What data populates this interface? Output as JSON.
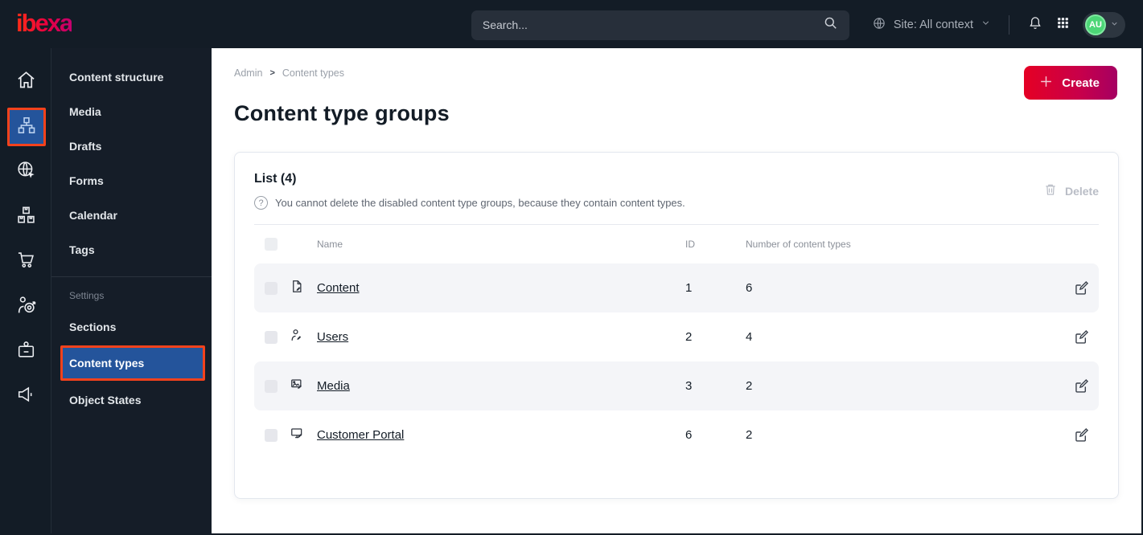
{
  "topbar": {
    "logo_text": "ibexa",
    "search": {
      "placeholder": "Search..."
    },
    "site_context": {
      "label": "Site: All context"
    },
    "avatar": {
      "initials": "AU"
    }
  },
  "sidebar": {
    "menu_items": [
      {
        "label": "Content structure"
      },
      {
        "label": "Media"
      },
      {
        "label": "Drafts"
      },
      {
        "label": "Forms"
      },
      {
        "label": "Calendar"
      },
      {
        "label": "Tags"
      }
    ],
    "section_label": "Settings",
    "settings_items": [
      {
        "label": "Sections"
      },
      {
        "label": "Content types"
      },
      {
        "label": "Object States"
      }
    ]
  },
  "breadcrumb": {
    "items": [
      "Admin",
      "Content types"
    ],
    "separator": ">"
  },
  "page": {
    "title": "Content type groups"
  },
  "toolbar": {
    "create_label": "Create"
  },
  "list_card": {
    "title": "List (4)",
    "info_icon_glyph": "?",
    "info_text": "You cannot delete the disabled content type groups, because they contain content types.",
    "delete_label": "Delete",
    "table": {
      "headers": {
        "name": "Name",
        "id": "ID",
        "count": "Number of content types"
      },
      "rows": [
        {
          "name": "Content",
          "id": "1",
          "count": "6"
        },
        {
          "name": "Users",
          "id": "2",
          "count": "4"
        },
        {
          "name": "Media",
          "id": "3",
          "count": "2"
        },
        {
          "name": "Customer Portal",
          "id": "6",
          "count": "2"
        }
      ]
    }
  },
  "colors": {
    "topbar_bg": "#131c26",
    "selected_blue": "#24549b",
    "accent_orange": "#f4421c",
    "create_gradient": [
      "#e50024",
      "#a50062"
    ],
    "avatar_green": "#4cd676",
    "stripe_row": "#f4f5f8"
  }
}
